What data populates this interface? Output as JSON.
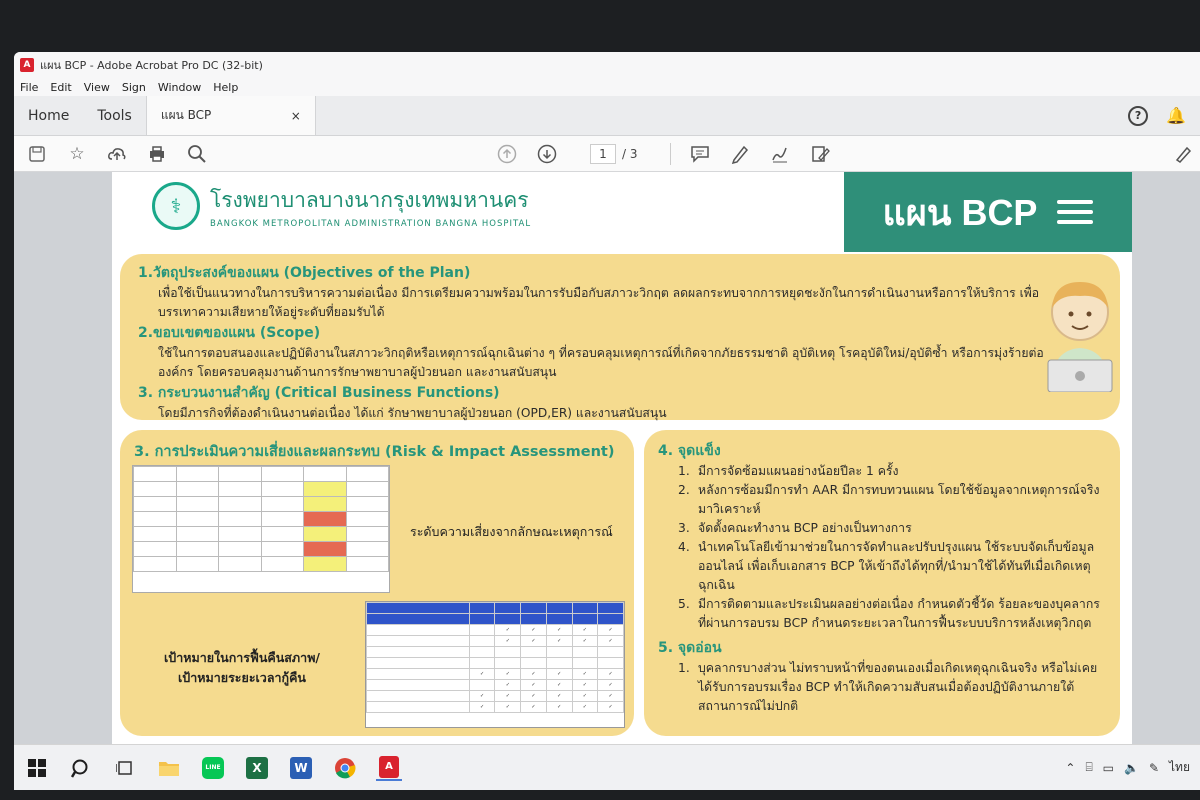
{
  "window": {
    "title": "แผน BCP - Adobe Acrobat Pro DC (32-bit)"
  },
  "menu": [
    "File",
    "Edit",
    "View",
    "Sign",
    "Window",
    "Help"
  ],
  "tabs": {
    "home": "Home",
    "tools": "Tools",
    "doc": "แผน BCP",
    "close": "×",
    "help": "?"
  },
  "page_nav": {
    "current": "1",
    "total": "/ 3"
  },
  "document": {
    "hospital_th": "โรงพยาบาลบางนากรุงเทพมหานคร",
    "hospital_en": "BANGKOK METROPOLITAN ADMINISTRATION BANGNA HOSPITAL",
    "banner_title": "แผน BCP",
    "s1_head": "1.วัตถุประสงค์ของแผน (Objectives of the Plan)",
    "s1_body": "เพื่อใช้เป็นแนวทางในการบริหารความต่อเนื่อง มีการเตรียมความพร้อมในการรับมือกับสภาวะวิกฤต ลดผลกระทบจากการหยุดชะงักในการดำเนินงานหรือการให้บริการ เพื่อบรรเทาความเสียหายให้อยู่ระดับที่ยอมรับได้",
    "s2_head": "2.ขอบเขตของแผน (Scope)",
    "s2_body": "ใช้ในการตอบสนองและปฏิบัติงานในสภาวะวิกฤติหรือเหตุการณ์ฉุกเฉินต่าง ๆ ที่ครอบคลุมเหตุการณ์ที่เกิดจากภัยธรรมชาติ อุบัติเหตุ โรคอุบัติใหม่/อุบัติซ้ำ หรือการมุ่งร้ายต่อองค์กร โดยครอบคลุมงานด้านการรักษาพยาบาลผู้ป่วยนอก และงานสนับสนุน",
    "s3_head": "3. กระบวนงานสำคัญ (Critical Business Functions)",
    "s3_body": "โดยมีภารกิจที่ต้องดำเนินงานต่อเนื่อง ได้แก่ รักษาพยาบาลผู้ป่วยนอก (OPD,ER) และงานสนับสนุน",
    "risk_head": "3. การประเมินความเสี่ยงและผลกระทบ (Risk & Impact Assessment)",
    "risk_caption": "ระดับความเสี่ยงจากลักษณะเหตุการณ์",
    "recovery_caption_1": "เป้าหมายในการฟื้นคืนสภาพ/",
    "recovery_caption_2": "เป้าหมายระยะเวลากู้คืน",
    "strength_head": "4. จุดแข็ง",
    "strengths": [
      {
        "n": "1.",
        "t": "มีการจัดซ้อมแผนอย่างน้อยปีละ 1 ครั้ง"
      },
      {
        "n": "2.",
        "t": "หลังการซ้อมมีการทำ AAR มีการทบทวนแผน โดยใช้ข้อมูลจากเหตุการณ์จริงมาวิเคราะห์"
      },
      {
        "n": "3.",
        "t": "จัดตั้งคณะทำงาน BCP อย่างเป็นทางการ"
      },
      {
        "n": "4.",
        "t": "นำเทคโนโลยีเข้ามาช่วยในการจัดทำและปรับปรุงแผน ใช้ระบบจัดเก็บข้อมูลออนไลน์ เพื่อเก็บเอกสาร BCP ให้เข้าถึงได้ทุกที่/นำมาใช้ได้ทันทีเมื่อเกิดเหตุฉุกเฉิน"
      },
      {
        "n": "5.",
        "t": "มีการติดตามและประเมินผลอย่างต่อเนื่อง กำหนดตัวชี้วัด ร้อยละของบุคลากรที่ผ่านการอบรม BCP กำหนดระยะเวลาในการฟื้นระบบบริการหลังเหตุวิกฤต"
      }
    ],
    "weak_head": "5. จุดอ่อน",
    "weaknesses": [
      {
        "n": "1.",
        "t": "บุคลากรบางส่วน ไม่ทราบหน้าที่ของตนเองเมื่อเกิดเหตุฉุกเฉินจริง หรือไม่เคยได้รับการอบรมเรื่อง BCP ทำให้เกิดความสับสนเมื่อต้องปฏิบัติงานภายใต้สถานการณ์ไม่ปกติ"
      }
    ]
  },
  "tray": {
    "lang": "ไทย"
  },
  "colors": {
    "accent": "#2f8f79",
    "panel": "#f5db8f",
    "risk_high": "#e56a52",
    "risk_mid": "#f4f07a"
  }
}
